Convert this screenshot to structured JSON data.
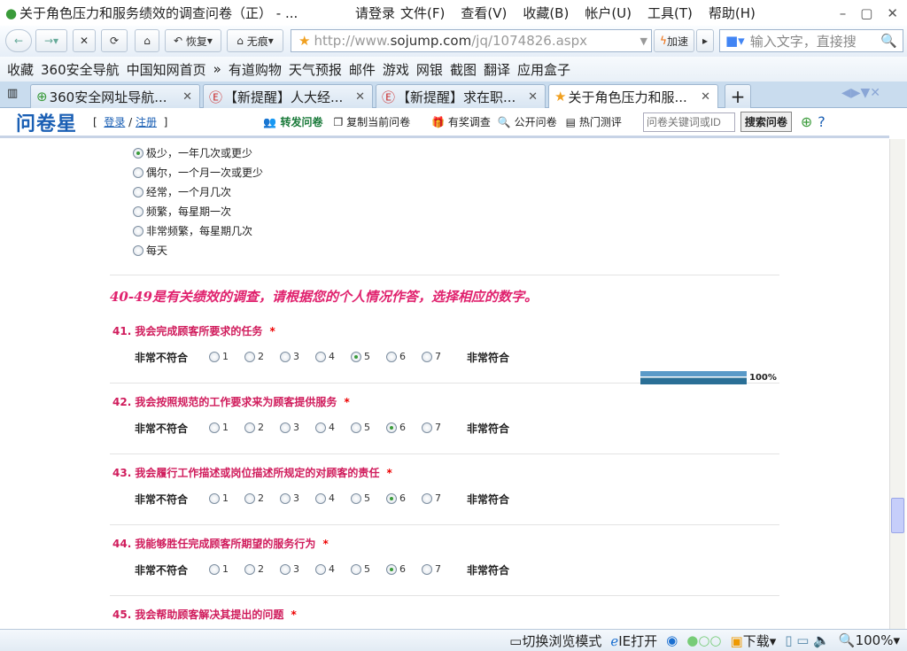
{
  "window": {
    "title": "关于角色压力和服务绩效的调查问卷（正） - ...",
    "login": "请登录",
    "menu": [
      "文件(F)",
      "查看(V)",
      "收藏(B)",
      "帐户(U)",
      "工具(T)",
      "帮助(H)"
    ]
  },
  "toolbar": {
    "restore": "恢复",
    "incognito": "无痕",
    "url_prefix": "http://www.",
    "url_domain": "sojump.com",
    "url_path": "/jq/1074826.aspx",
    "speedup": "加速",
    "search_placeholder": "输入文字，直接搜"
  },
  "favorites": [
    "收藏",
    "360安全导航",
    "中国知网首页",
    "»",
    "有道购物",
    "天气预报",
    "邮件",
    "游戏",
    "网银",
    "截图",
    "翻译",
    "应用盒子"
  ],
  "tabs": [
    {
      "label": "360安全网址导航..."
    },
    {
      "label": "【新提醒】人大经..."
    },
    {
      "label": "【新提醒】求在职..."
    },
    {
      "label": "关于角色压力和服..."
    }
  ],
  "site": {
    "logo": "问卷星",
    "login": "登录",
    "register": "注册",
    "forward": "转发问卷",
    "copy": "复制当前问卷",
    "reward": "有奖调查",
    "public": "公开问卷",
    "hot": "热门测评",
    "search_placeholder": "问卷关键词或ID",
    "search_btn": "搜索问卷"
  },
  "prev_options": [
    {
      "label": "极少，一年几次或更少",
      "checked": true
    },
    {
      "label": "偶尔，一个月一次或更少",
      "checked": false
    },
    {
      "label": "经常，一个月几次",
      "checked": false
    },
    {
      "label": "频繁，每星期一次",
      "checked": false
    },
    {
      "label": "非常频繁，每星期几次",
      "checked": false
    },
    {
      "label": "每天",
      "checked": false
    }
  ],
  "section_title": "40-49是有关绩效的调查，请根据您的个人情况作答，选择相应的数字。",
  "scale": {
    "left": "非常不符合",
    "right": "非常符合",
    "points": [
      "1",
      "2",
      "3",
      "4",
      "5",
      "6",
      "7"
    ]
  },
  "questions": [
    {
      "title": "41. 我会完成顾客所要求的任务",
      "selected": "5"
    },
    {
      "title": "42. 我会按照规范的工作要求来为顾客提供服务",
      "selected": "6"
    },
    {
      "title": "43. 我会履行工作描述或岗位描述所规定的对顾客的责任",
      "selected": "6"
    },
    {
      "title": "44. 我能够胜任完成顾客所期望的服务行为",
      "selected": "6"
    },
    {
      "title": "45. 我会帮助顾客解决其提出的问题",
      "selected": null
    }
  ],
  "required_mark": "*",
  "progress": {
    "value": 100,
    "label": "100%"
  },
  "status": {
    "mode": "切换浏览模式",
    "ie": "IE打开",
    "download": "下载",
    "zoom": "100%"
  }
}
